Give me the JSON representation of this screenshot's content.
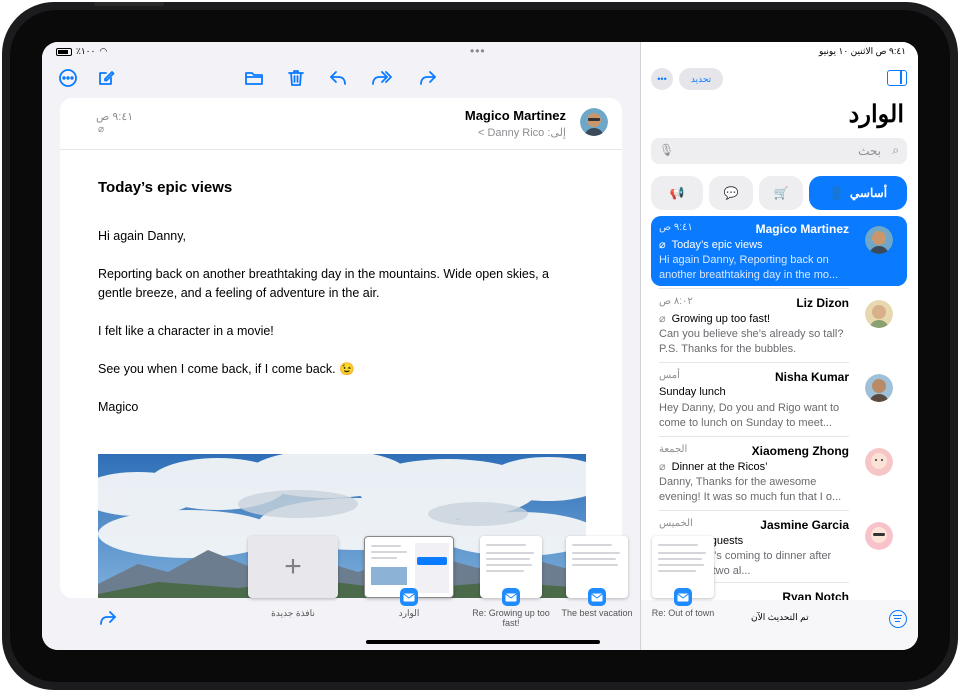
{
  "status_bar": {
    "right_text": "٩:٤١ ص  الاثنين ١٠ يونيو",
    "left_text": "٪١٠٠"
  },
  "toolbar": {
    "icons": [
      "more-icon",
      "compose-icon",
      "folder-icon",
      "trash-icon",
      "reply-icon",
      "reply-all-icon",
      "forward-icon"
    ]
  },
  "message": {
    "sender": "Magico Martinez",
    "to_label": "إلى: Danny Rico >",
    "time": "٩:٤١ ص",
    "subject": "Today’s epic views",
    "paragraphs": [
      "Hi again Danny,",
      "Reporting back on another breathtaking day in the mountains. Wide open skies, a gentle breeze, and a feeling of adventure in the air.",
      "I felt like a character in a movie!",
      "See you when I come back, if I come back. 😉",
      "Magico"
    ]
  },
  "list": {
    "update_button": "تحديد",
    "title": "الوارد",
    "search_placeholder": "بحث",
    "primary_category": "أساسي",
    "updated_text": "تم التحديث الآن",
    "messages": [
      {
        "name": "Magico Martinez",
        "date": "٩:٤١ ص",
        "subject": "Today’s epic views",
        "preview": "Hi again Danny, Reporting back on another breathtaking day in the mo...",
        "selected": true,
        "avatar_color": "#c9a27a"
      },
      {
        "name": "Liz Dizon",
        "date": "٨:٠٢ ص",
        "subject": "Growing up too fast!",
        "preview": "Can you believe she’s already so tall? P.S. Thanks for the bubbles.",
        "selected": false,
        "avatar_color": "#d8c39a"
      },
      {
        "name": "Nisha Kumar",
        "date": "أمس",
        "subject": "Sunday lunch",
        "preview": "Hey Danny, Do you and Rigo want to come to lunch on Sunday to meet...",
        "selected": false,
        "avatar_color": "#b89a7e"
      },
      {
        "name": "Xiaomeng Zhong",
        "date": "الجمعة",
        "subject": "Dinner at the Ricos’",
        "preview": "Danny, Thanks for the awesome evening! It was so much fun that I o...",
        "selected": false,
        "avatar_color": "#f4b6b6"
      },
      {
        "name": "Jasmine Garcia",
        "date": "الخميس",
        "subject": "Special guests",
        "preview": "Guess who’s coming to dinner after all? These two al...",
        "selected": false,
        "avatar_color": "#f7c2c9"
      },
      {
        "name": "Ryan Notch",
        "date": "",
        "subject": "",
        "preview": "",
        "selected": false,
        "avatar_color": "#d0b48e"
      }
    ]
  },
  "switcher": {
    "new_window": "نافذة جديدة",
    "items": [
      {
        "label": "الوارد"
      },
      {
        "label": "Re: Growing up too fast!"
      },
      {
        "label": "The best vacation"
      },
      {
        "label": "Re: Out of town"
      }
    ]
  }
}
